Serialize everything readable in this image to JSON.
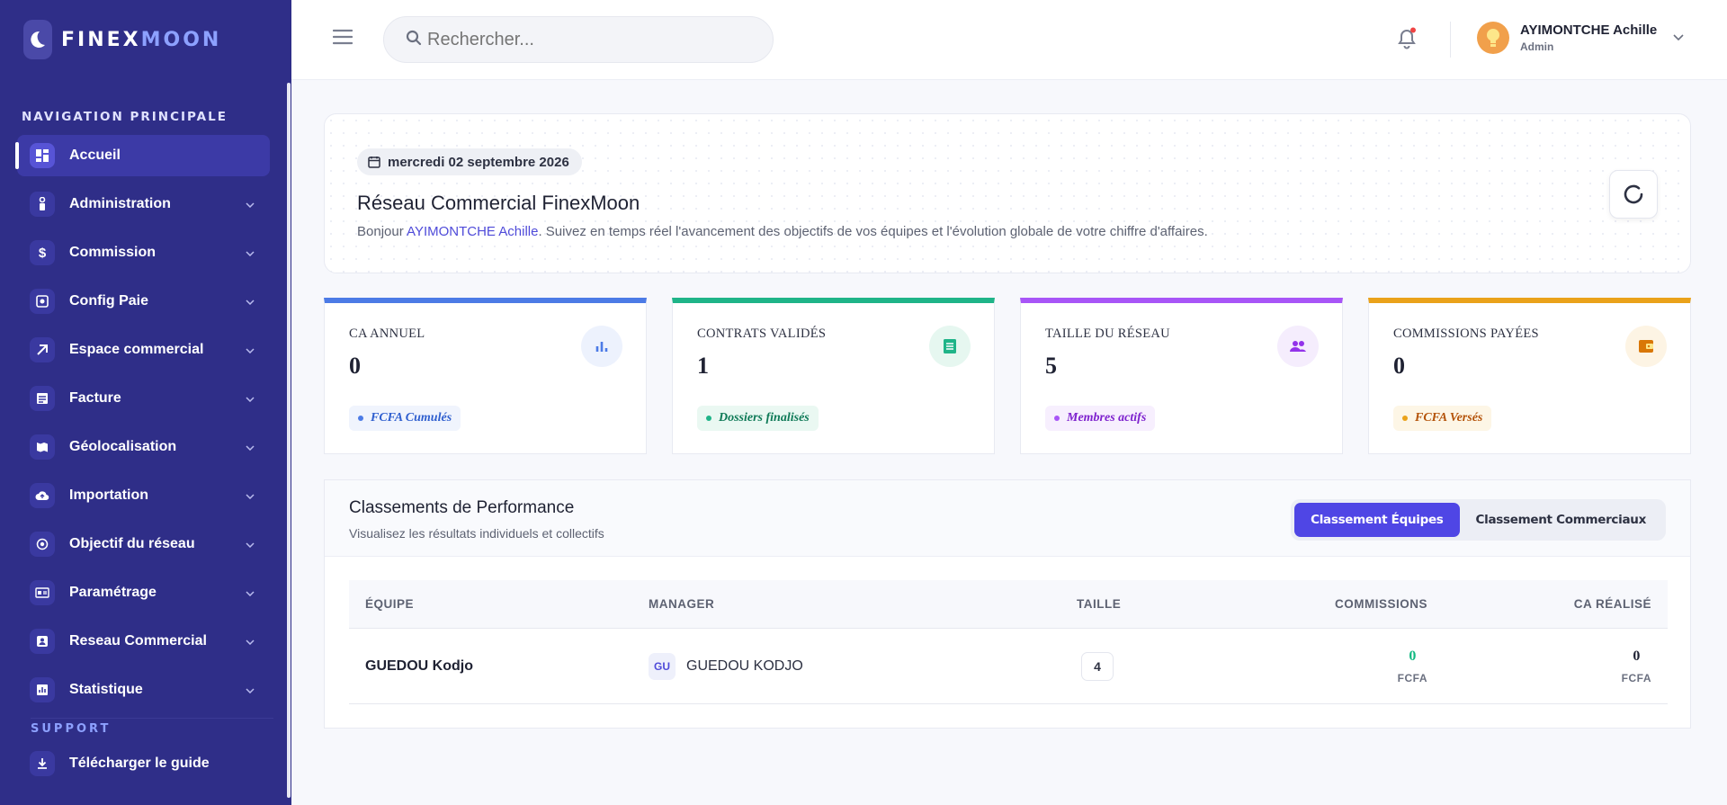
{
  "brand": {
    "part1": "FINEX",
    "part2": "MOON"
  },
  "colors": {
    "sidebar": "#2f2e88",
    "accent": "#4f46e5",
    "blue": "#4c7be6",
    "green": "#1fb488",
    "purple": "#a855f7",
    "orange": "#eaa21a"
  },
  "sidebar": {
    "section_title": "NAVIGATION PRINCIPALE",
    "items": [
      {
        "label": "Accueil",
        "icon": "dashboard-icon",
        "active": true
      },
      {
        "label": "Administration",
        "icon": "admin-icon"
      },
      {
        "label": "Commission",
        "icon": "dollar-icon"
      },
      {
        "label": "Config Paie",
        "icon": "payroll-config-icon"
      },
      {
        "label": "Espace commercial",
        "icon": "commercial-space-icon"
      },
      {
        "label": "Facture",
        "icon": "invoice-icon"
      },
      {
        "label": "Géolocalisation",
        "icon": "map-icon"
      },
      {
        "label": "Importation",
        "icon": "cloud-upload-icon"
      },
      {
        "label": "Objectif du réseau",
        "icon": "target-icon"
      },
      {
        "label": "Paramétrage",
        "icon": "settings-card-icon"
      },
      {
        "label": "Reseau Commercial",
        "icon": "network-icon"
      },
      {
        "label": "Statistique",
        "icon": "stats-icon"
      }
    ],
    "support_title": "SUPPORT",
    "support_items": [
      {
        "label": "Télécharger le guide",
        "icon": "download-icon"
      }
    ]
  },
  "header": {
    "search_placeholder": "Rechercher...",
    "user_name": "AYIMONTCHE Achille",
    "user_role": "Admin"
  },
  "hero": {
    "date": "mercredi 02 septembre 2026",
    "title": "Réseau Commercial FinexMoon",
    "greeting": "Bonjour ",
    "highlight_name": "AYIMONTCHE Achille",
    "subtitle_rest": ". Suivez en temps réel l'avancement des objectifs de vos équipes et l'évolution globale de votre chiffre d'affaires."
  },
  "kpis": [
    {
      "label": "CA ANNUEL",
      "value": "0",
      "badge": "FCFA Cumulés",
      "color": "#4c7be6",
      "icon": "bar-chart-icon"
    },
    {
      "label": "CONTRATS VALIDÉS",
      "value": "1",
      "badge": "Dossiers finalisés",
      "color": "#1fb488",
      "icon": "document-icon"
    },
    {
      "label": "TAILLE DU RÉSEAU",
      "value": "5",
      "badge": "Membres actifs",
      "color": "#a855f7",
      "icon": "people-icon"
    },
    {
      "label": "COMMISSIONS PAYÉES",
      "value": "0",
      "badge": "FCFA Versés",
      "color": "#eaa21a",
      "icon": "wallet-icon"
    }
  ],
  "performance": {
    "title": "Classements de Performance",
    "subtitle": "Visualisez les résultats individuels et collectifs",
    "tabs": [
      "Classement Équipes",
      "Classement Commerciaux"
    ],
    "columns": [
      "ÉQUIPE",
      "MANAGER",
      "TAILLE",
      "COMMISSIONS",
      "CA RÉALISÉ"
    ],
    "rows": [
      {
        "team": "GUEDOU Kodjo",
        "manager_initials": "GU",
        "manager": "GUEDOU KODJO",
        "size": "4",
        "commissions": "0",
        "commissions_unit": "FCFA",
        "ca": "0",
        "ca_unit": "FCFA"
      }
    ]
  }
}
